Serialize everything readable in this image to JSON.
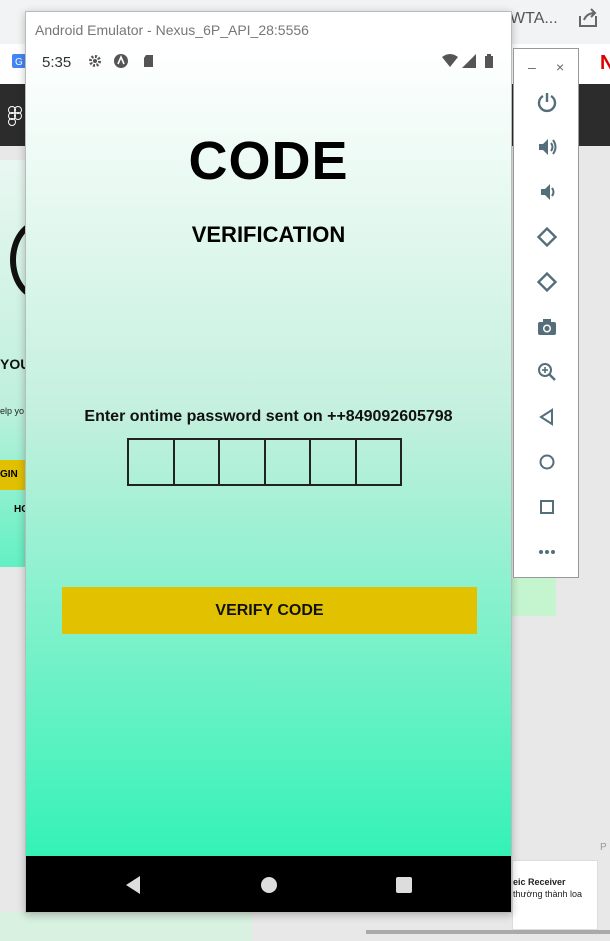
{
  "background": {
    "tab_title_fragment": "WTA...",
    "left_panel": {
      "you_text": "YOU",
      "help_text": "elp yo",
      "button_text": "GIN",
      "ho_text": "HO"
    },
    "card": {
      "line1": "eic Receiver",
      "line2": "thường thành loa"
    },
    "corner_text": "P"
  },
  "emulator": {
    "window_title": "Android Emulator - Nexus_6P_API_28:5556",
    "minimize_label": "–",
    "close_label": "×"
  },
  "status_bar": {
    "time": "5:35"
  },
  "screen": {
    "title": "CODE",
    "subtitle": "VERIFICATION",
    "otp_prompt": "Enter ontime password sent on ++849092605798",
    "otp_boxes": 6,
    "verify_button_label": "VERIFY CODE",
    "accent_color": "#e2c200",
    "gradient_colors": [
      "#ffffff",
      "#c4f0de",
      "#34f2b6"
    ]
  },
  "nav_bar": {
    "icons": [
      "back-icon",
      "home-icon",
      "recents-icon"
    ]
  },
  "toolbar": {
    "icons": [
      "power-icon",
      "volume-up-icon",
      "volume-down-icon",
      "rotate-left-icon",
      "rotate-right-icon",
      "camera-icon",
      "zoom-icon",
      "back-icon",
      "home-icon",
      "overview-icon",
      "more-icon"
    ]
  }
}
